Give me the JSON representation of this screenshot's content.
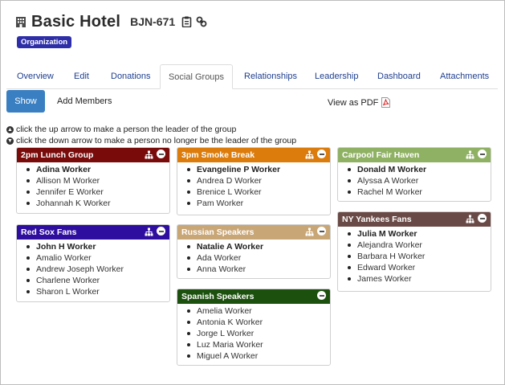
{
  "header": {
    "title": "Basic Hotel",
    "code": "BJN-671",
    "badge": "Organization",
    "icons": [
      "building-icon",
      "clipboard-icon",
      "link-icon"
    ]
  },
  "tabs": [
    {
      "label": "Overview",
      "active": false
    },
    {
      "label": "Edit",
      "active": false
    },
    {
      "label": "Donations",
      "active": false
    },
    {
      "label": "Social Groups",
      "active": true
    },
    {
      "label": "Relationships",
      "active": false
    },
    {
      "label": "Leadership",
      "active": false
    },
    {
      "label": "Dashboard",
      "active": false
    },
    {
      "label": "Attachments",
      "active": false
    }
  ],
  "toolbar": {
    "show_label": "Show",
    "add_members_label": "Add Members",
    "pdf_label": "View as PDF"
  },
  "instructions": {
    "up": "click the up arrow to make a person the leader of the group",
    "down": "click the down arrow to make a person no longer be the leader of the group"
  },
  "groups": [
    {
      "name": "2pm Lunch Group",
      "color": "#7a0b0b",
      "leader": "Adina Worker",
      "members": [
        "Allison M Worker",
        "Jennifer E Worker",
        "Johannah K Worker"
      ]
    },
    {
      "name": "3pm Smoke Break",
      "color": "#db7c0c",
      "leader": "Evangeline P Worker",
      "members": [
        "Andrea D Worker",
        "Brenice L Worker",
        "Pam Worker"
      ]
    },
    {
      "name": "Carpool Fair Haven",
      "color": "#8fb163",
      "leader": "Donald M Worker",
      "members": [
        "Alyssa A Worker",
        "Rachel M Worker"
      ]
    },
    {
      "name": "Red Sox Fans",
      "color": "#2e0e9e",
      "leader": "John H Worker",
      "members": [
        "Amalio Worker",
        "Andrew Joseph Worker",
        "Charlene Worker",
        "Sharon L Worker"
      ]
    },
    {
      "name": "Russian Speakers",
      "color": "#c9a676",
      "leader": "Natalie A Worker",
      "members": [
        "Ada Worker",
        "Anna Worker"
      ]
    },
    {
      "name": "NY Yankees Fans",
      "color": "#6a4a46",
      "leader": "Julia M Worker",
      "members": [
        "Alejandra Worker",
        "Barbara H Worker",
        "Edward Worker",
        "James Worker"
      ]
    },
    {
      "name": "Spanish Speakers",
      "color": "#1c500e",
      "leader": "",
      "members": [
        "Amelia Worker",
        "Antonia K Worker",
        "Jorge L Worker",
        "Luz Maria Worker",
        "Miguel A Worker"
      ]
    }
  ]
}
